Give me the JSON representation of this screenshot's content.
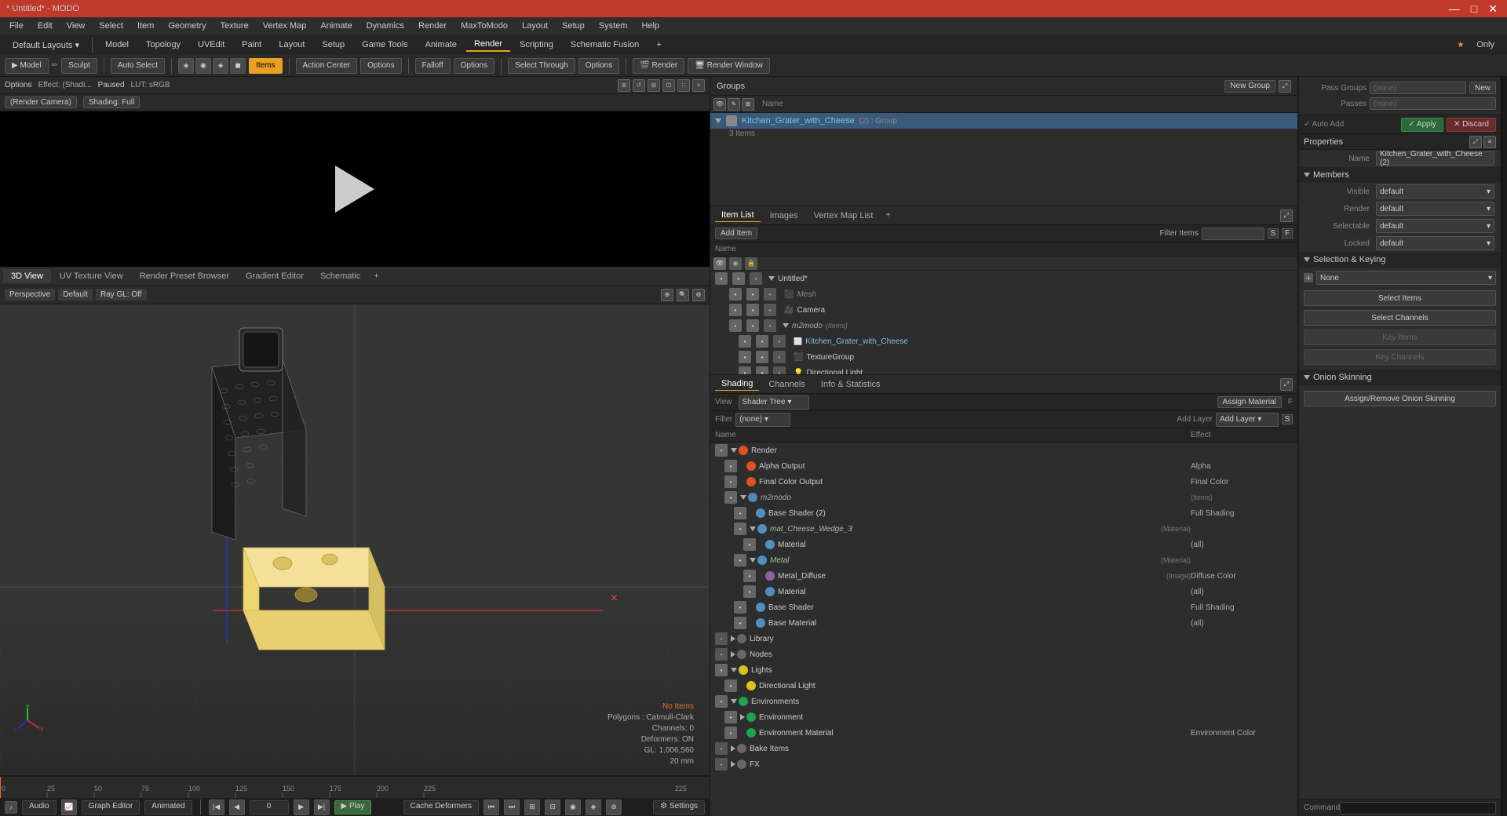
{
  "titlebar": {
    "title": "* Untitled* - MODO",
    "minimize": "—",
    "maximize": "□",
    "close": "✕"
  },
  "menubar": {
    "items": [
      "File",
      "Edit",
      "View",
      "Select",
      "Item",
      "Geometry",
      "Texture",
      "Vertex Map",
      "Animate",
      "Dynamics",
      "Render",
      "MaxToModo",
      "Layout",
      "Setup",
      "System",
      "Help"
    ]
  },
  "main_toolbar": {
    "preset": "Default Layouts",
    "layout_tabs": [
      "Model",
      "Topology",
      "UVEdit",
      "Paint",
      "Layout",
      "Setup",
      "Game Tools",
      "Animate",
      "Render",
      "Scripting",
      "Schematic Fusion"
    ],
    "add_tab": "+",
    "star_only": "★ Only"
  },
  "tool_toolbar": {
    "model_btn": "Model",
    "sculpt_btn": "Sculpt",
    "auto_select": "Auto Select",
    "items_btn": "Items",
    "action_center": "Action Center",
    "options1": "Options",
    "falloff": "Falloff",
    "options2": "Options",
    "select_through": "Select Through",
    "options3": "Options",
    "render": "Render",
    "render_window": "Render Window"
  },
  "render_panel": {
    "options": "Options",
    "effect_label": "Effect: (Shadi...",
    "paused": "Paused",
    "lut": "LUT: sRGB",
    "render_camera": "(Render Camera)",
    "shading": "Shading: Full",
    "icons": [
      "⊕",
      "↺",
      "⊞",
      "⊡",
      "∷",
      "≡"
    ]
  },
  "view_tabs": {
    "tabs": [
      "3D View",
      "UV Texture View",
      "Render Preset Browser",
      "Gradient Editor",
      "Schematic"
    ],
    "add": "+"
  },
  "viewport": {
    "view_mode": "Perspective",
    "shading": "Default",
    "ray_gl": "Ray GL: Off",
    "status": {
      "items": "No Items",
      "polygons": "Polygons : Catmull-Clark",
      "channels": "Channels: 0",
      "deformers": "Deformers: ON",
      "gl": "GL: 1,006,560",
      "scale": "20 mm"
    }
  },
  "groups_panel": {
    "title": "Groups",
    "new_group": "New Group",
    "col_name": "Name",
    "items": [
      {
        "name": "Kitchen_Grater_with_Cheese",
        "type": "group",
        "sub": "(2) : Group",
        "count": "3 Items",
        "expanded": true
      }
    ]
  },
  "item_list": {
    "tabs": [
      "Item List",
      "Images",
      "Vertex Map List"
    ],
    "add_btn": "Add Item",
    "filter_btn": "Filter Items",
    "col_name": "Name",
    "col_s": "S",
    "col_f": "F",
    "items": [
      {
        "name": "Untitled*",
        "indent": 0,
        "type": "scene",
        "expanded": true
      },
      {
        "name": "Mesh",
        "indent": 1,
        "type": "mesh",
        "color": "gray"
      },
      {
        "name": "Camera",
        "indent": 1,
        "type": "camera"
      },
      {
        "name": "m2modo",
        "indent": 1,
        "type": "group",
        "expanded": true,
        "italic": true
      },
      {
        "name": "Kitchen_Grater_with_Cheese",
        "indent": 2,
        "type": "mesh"
      },
      {
        "name": "TextureGroup",
        "indent": 2,
        "type": "texgroup"
      },
      {
        "name": "Directional Light",
        "indent": 2,
        "type": "light"
      }
    ]
  },
  "shader_tree": {
    "tabs": [
      "Shading",
      "Channels",
      "Info & Statistics"
    ],
    "view_label": "View",
    "view_options": [
      "Shader Tree"
    ],
    "assign_material": "Assign Material",
    "filter_label": "Filter",
    "filter_options": [
      "(none)"
    ],
    "add_layer": "Add Layer",
    "col_name": "Name",
    "col_effect": "Effect",
    "col_s": "S",
    "items": [
      {
        "name": "Render",
        "indent": 0,
        "type": "render",
        "effect": "",
        "expanded": true
      },
      {
        "name": "Alpha Output",
        "indent": 1,
        "type": "output",
        "effect": "Alpha"
      },
      {
        "name": "Final Color Output",
        "indent": 1,
        "type": "output",
        "effect": "Final Color"
      },
      {
        "name": "m2modo",
        "indent": 1,
        "type": "group",
        "effect": "",
        "italic": true,
        "expanded": true
      },
      {
        "name": "Base Shader (2)",
        "indent": 2,
        "type": "shader",
        "effect": "Full Shading"
      },
      {
        "name": "mat_Cheese_Wedge_3 (Material)",
        "indent": 2,
        "type": "material",
        "effect": "",
        "italic": true,
        "expanded": true
      },
      {
        "name": "Material",
        "indent": 3,
        "type": "material-item",
        "effect": "(all)"
      },
      {
        "name": "Metal (Material)",
        "indent": 2,
        "type": "material",
        "effect": "",
        "italic": true,
        "expanded": true
      },
      {
        "name": "Metal_Diffuse (Image)",
        "indent": 3,
        "type": "image",
        "effect": "Diffuse Color"
      },
      {
        "name": "Material",
        "indent": 3,
        "type": "material-item",
        "effect": "(all)"
      },
      {
        "name": "Base Shader",
        "indent": 2,
        "type": "shader",
        "effect": "Full Shading"
      },
      {
        "name": "Base Material",
        "indent": 2,
        "type": "material-item",
        "effect": "(all)"
      },
      {
        "name": "Library",
        "indent": 0,
        "type": "library",
        "effect": "",
        "expanded": false
      },
      {
        "name": "Nodes",
        "indent": 0,
        "type": "nodes",
        "effect": "",
        "expanded": false
      },
      {
        "name": "Lights",
        "indent": 0,
        "type": "lights",
        "effect": "",
        "expanded": true
      },
      {
        "name": "Directional Light",
        "indent": 1,
        "type": "light-item",
        "effect": ""
      },
      {
        "name": "Environments",
        "indent": 0,
        "type": "environments",
        "effect": "",
        "expanded": true
      },
      {
        "name": "Environment",
        "indent": 1,
        "type": "env-item",
        "effect": ""
      },
      {
        "name": "Environment Material",
        "indent": 1,
        "type": "env-mat",
        "effect": "Environment Color"
      },
      {
        "name": "Bake Items",
        "indent": 0,
        "type": "bake",
        "effect": "",
        "expanded": false
      },
      {
        "name": "FX",
        "indent": 0,
        "type": "fx",
        "effect": "",
        "expanded": false
      }
    ]
  },
  "properties": {
    "title": "Properties",
    "pass_groups_label": "Pass Groups",
    "passes_label": "Passes",
    "pass_groups_value": "(none)",
    "passes_value": "(none)",
    "new_btn": "New",
    "auto_add_label": "Auto Add",
    "apply_btn": "Apply",
    "discard_btn": "Discard",
    "name_label": "Name",
    "name_value": "Kitchen_Grater_with_Cheese (2)",
    "members_label": "Members",
    "visible_label": "Visible",
    "visible_value": "default",
    "render_label": "Render",
    "render_value": "default",
    "selectable_label": "Selectable",
    "selectable_value": "default",
    "locked_label": "Locked",
    "locked_value": "default",
    "selection_keying": "Selection & Keying",
    "none_label": "None",
    "select_items": "Select Items",
    "select_channels": "Select Channels",
    "key_items": "Key Items",
    "key_channels": "Key Channels",
    "assign_remove_onion": "Assign/Remove Onion Skinning",
    "onion_skinning": "Onion Skinning",
    "command_label": "Command"
  },
  "bottombar": {
    "audio": "Audio",
    "graph_editor": "Graph Editor",
    "animated": "Animated",
    "cache_deformers": "Cache Deformers",
    "settings": "Settings",
    "play": "Play",
    "frame_start": "0"
  },
  "timeline": {
    "ticks": [
      0,
      25,
      50,
      75,
      100,
      125,
      150,
      175,
      200,
      225
    ]
  }
}
